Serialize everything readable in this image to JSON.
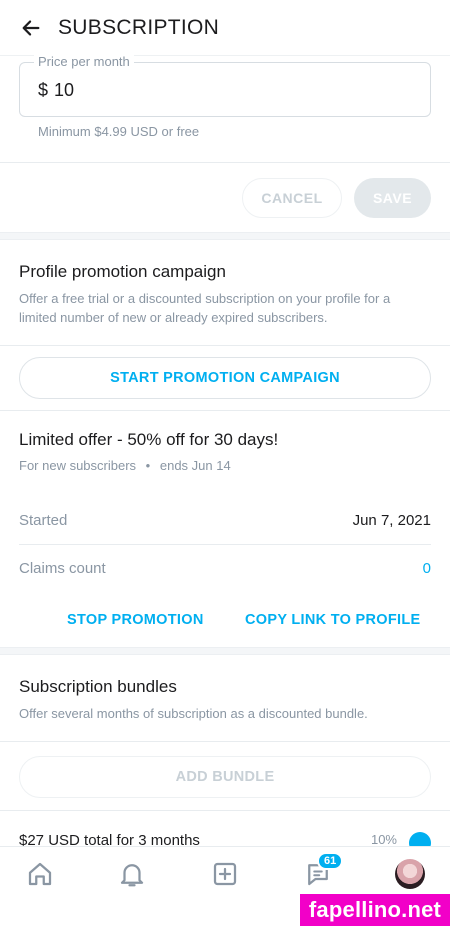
{
  "header": {
    "title": "SUBSCRIPTION"
  },
  "price": {
    "label": "Price per month",
    "currency": "$",
    "value": "10",
    "hint": "Minimum $4.99 USD or free"
  },
  "form_actions": {
    "cancel_label": "CANCEL",
    "save_label": "SAVE"
  },
  "promotion": {
    "title": "Profile promotion campaign",
    "description": "Offer a free trial or a discounted subscription on your profile for a limited number of new or already expired subscribers.",
    "start_label": "START PROMOTION CAMPAIGN"
  },
  "offer": {
    "title": "Limited offer - 50% off for 30 days!",
    "audience": "For new subscribers",
    "separator": "•",
    "ends": "ends Jun 14",
    "started_label": "Started",
    "started_value": "Jun 7, 2021",
    "claims_label": "Claims count",
    "claims_value": "0",
    "stop_label": "STOP PROMOTION",
    "copy_label": "COPY LINK TO PROFILE"
  },
  "bundles": {
    "title": "Subscription bundles",
    "description": "Offer several months of subscription as a discounted bundle.",
    "add_label": "ADD BUNDLE",
    "partial_row": "$27 USD total for 3 months",
    "partial_pct": "10%"
  },
  "tabbar": {
    "items": [
      "home-icon",
      "bell-icon",
      "add-post-icon",
      "messages-icon",
      "avatar"
    ],
    "messages_badge": "61"
  },
  "watermark": "fapellino.net",
  "colors": {
    "accent": "#00aff0",
    "muted": "#8a96a3",
    "watermark": "#f200c8"
  }
}
